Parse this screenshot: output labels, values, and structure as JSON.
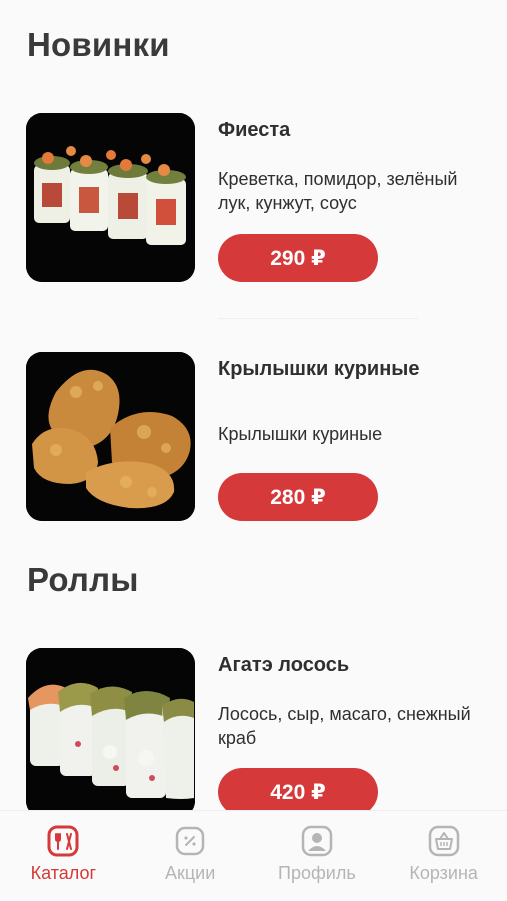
{
  "sections": [
    {
      "title": "Новинки",
      "items": [
        {
          "name": "Фиеста",
          "description": "Креветка, помидор, зелёный лук, кунжут, соус",
          "price": "290 ₽",
          "image": "sushi-rolls-image"
        },
        {
          "name": "Крылышки куриные",
          "description": "Крылышки куриные",
          "price": "280 ₽",
          "image": "chicken-wings-image"
        }
      ]
    },
    {
      "title": "Роллы",
      "items": [
        {
          "name": "Агатэ лосось",
          "description": "Лосось, сыр, масаго, снежный краб",
          "price": "420 ₽",
          "image": "salmon-rolls-image"
        }
      ]
    }
  ],
  "tabs": [
    {
      "label": "Каталог",
      "icon": "catalog-icon",
      "active": true
    },
    {
      "label": "Акции",
      "icon": "discount-icon",
      "active": false
    },
    {
      "label": "Профиль",
      "icon": "profile-icon",
      "active": false
    },
    {
      "label": "Корзина",
      "icon": "basket-icon",
      "active": false
    }
  ],
  "colors": {
    "accent": "#d6393a",
    "inactive": "#b5b5b5",
    "background": "#fafafa"
  }
}
